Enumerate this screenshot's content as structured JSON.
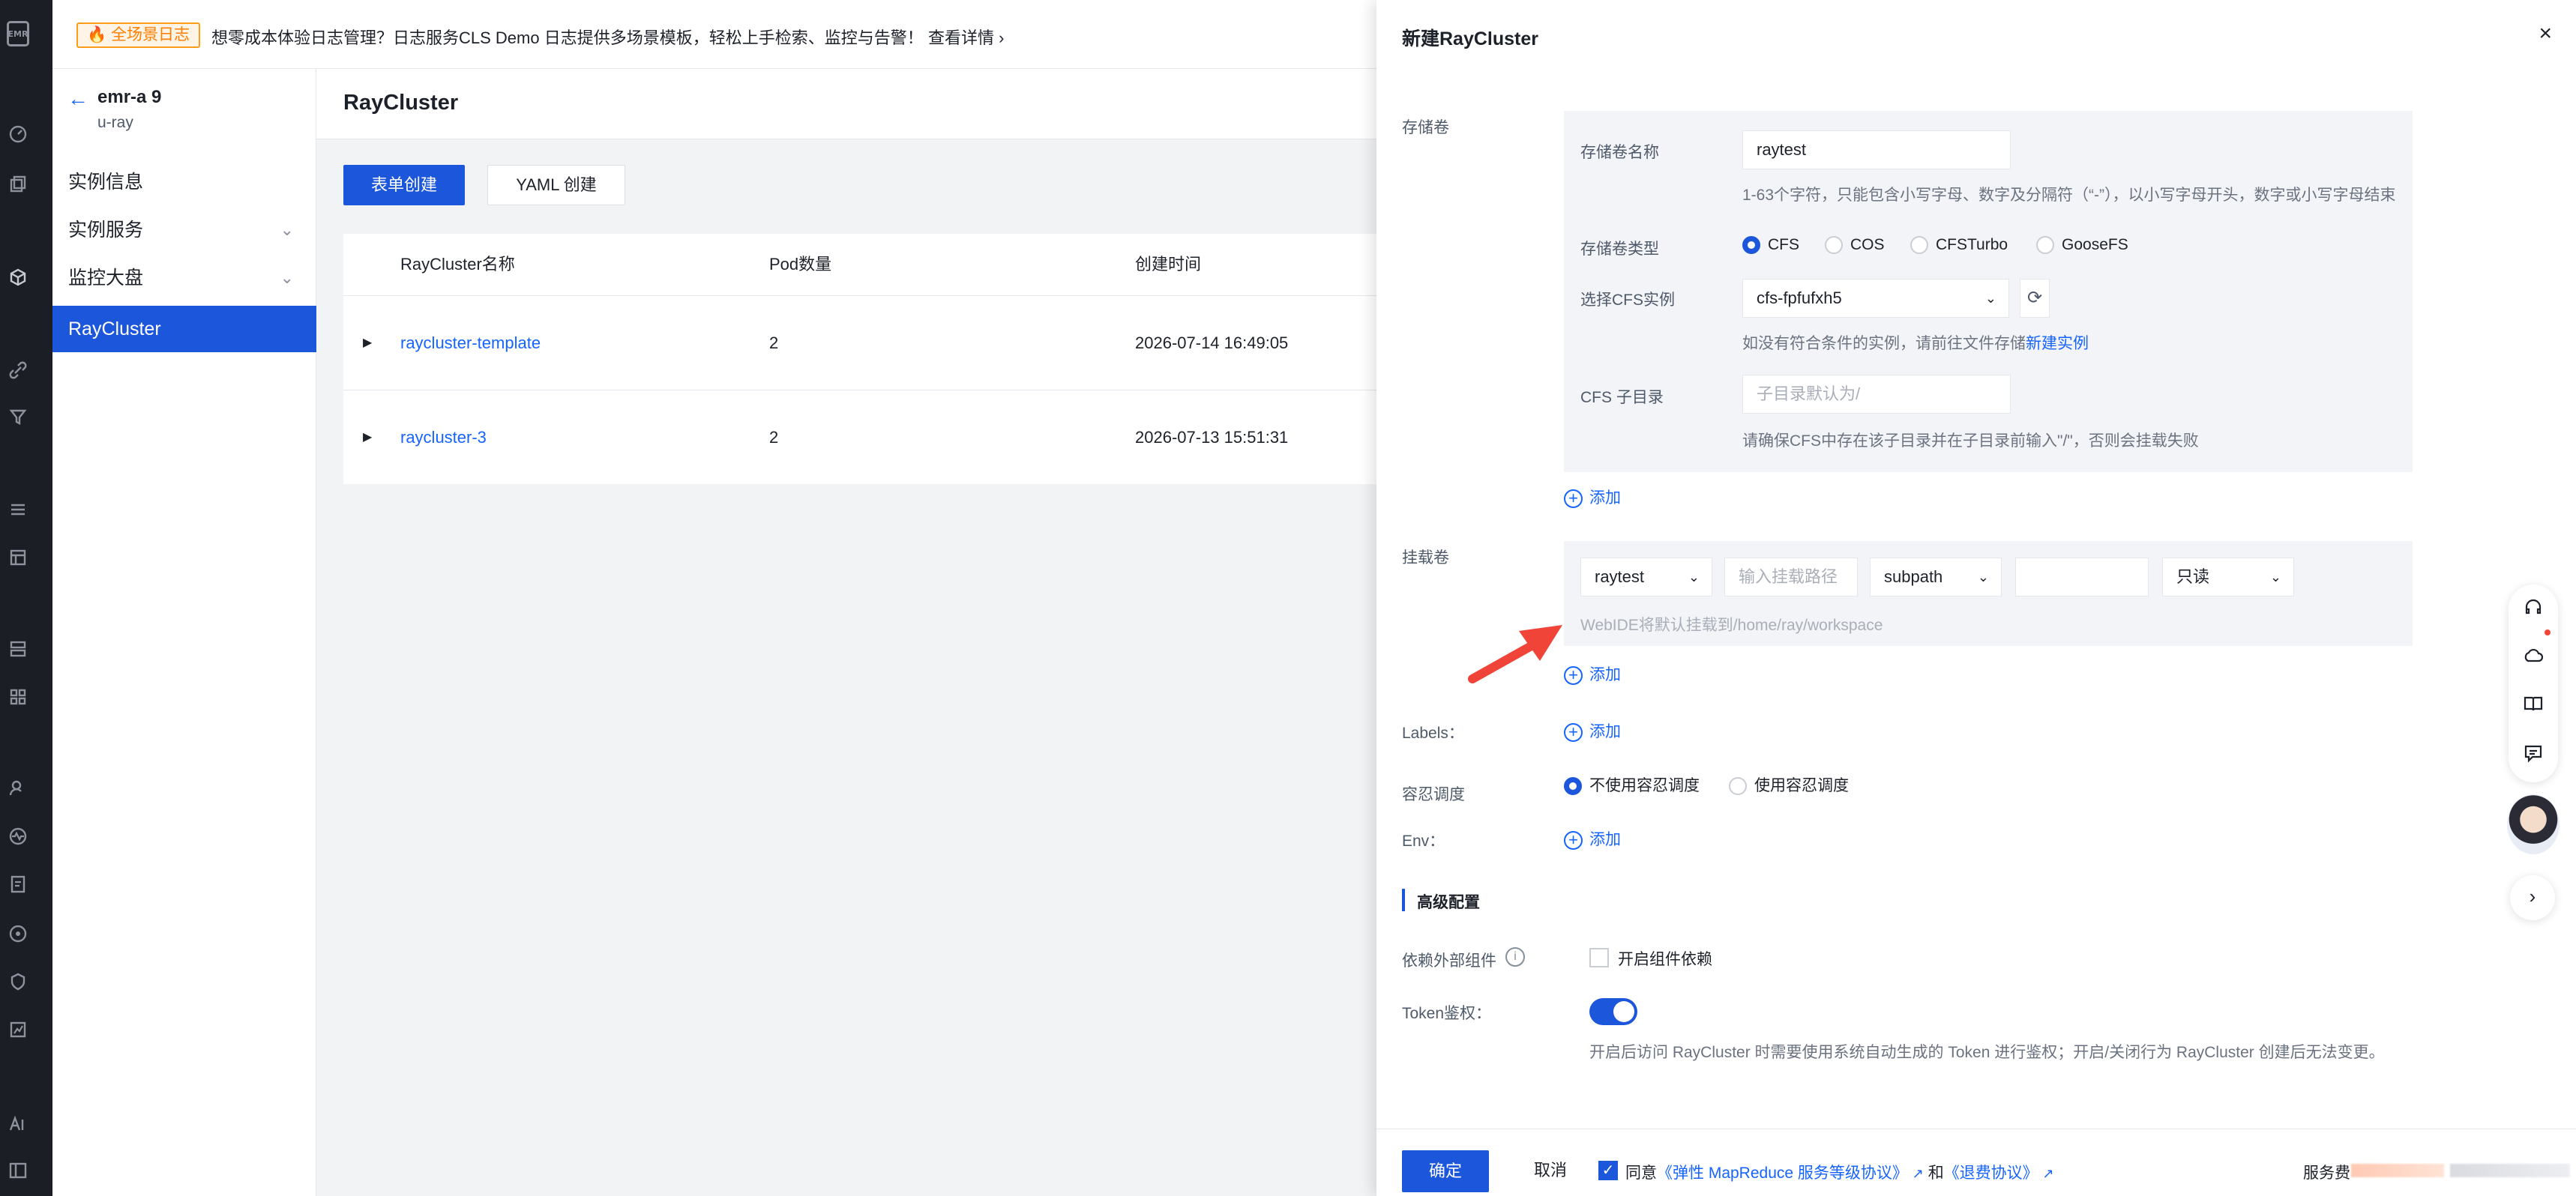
{
  "banner": {
    "tag": "全场景日志",
    "text": "想零成本体验日志管理？日志服务CLS Demo 日志提供多场景模板，轻松上手检索、监控与告警！",
    "link": "查看详情 ›"
  },
  "rail": {
    "logo": "EMR"
  },
  "subnav": {
    "back_icon": "arrow-left-icon",
    "title": "emr-a 9",
    "subtitle": "u-ray",
    "items": [
      {
        "label": "实例信息",
        "chevron": false
      },
      {
        "label": "实例服务",
        "chevron": true
      },
      {
        "label": "监控大盘",
        "chevron": true
      },
      {
        "label": "RayCluster",
        "chevron": false,
        "active": true
      }
    ]
  },
  "main": {
    "title": "RayCluster",
    "buttons": {
      "form_create": "表单创建",
      "yaml_create": "YAML 创建"
    },
    "table": {
      "columns": [
        "RayCluster名称",
        "Pod数量",
        "创建时间"
      ],
      "rows": [
        {
          "name": "raycluster-template",
          "pods": "2",
          "created": "2026-07-14 16:49:05"
        },
        {
          "name": "raycluster-3",
          "pods": "2",
          "created": "2026-07-13 15:51:31"
        }
      ]
    }
  },
  "drawer": {
    "title": "新建RayCluster",
    "close": "×",
    "storage": {
      "label": "存储卷",
      "name_label": "存储卷名称",
      "name_value": "raytest",
      "name_hint": "1-63个字符，只能包含小写字母、数字及分隔符（“-”），以小写字母开头，数字或小写字母结束",
      "type_label": "存储卷类型",
      "types": [
        "CFS",
        "COS",
        "CFSTurbo",
        "GooseFS"
      ],
      "type_selected": "CFS",
      "cfs_label": "选择CFS实例",
      "cfs_value": "cfs-fpfufxh5",
      "cfs_hint_prefix": "如没有符合条件的实例，请前往文件存储",
      "cfs_hint_link": "新建实例",
      "subdir_label": "CFS 子目录",
      "subdir_placeholder": "子目录默认为/",
      "subdir_hint": "请确保CFS中存在该子目录并在子目录前输入\"/\"，否则会挂载失败",
      "add": "添加"
    },
    "mount": {
      "label": "挂载卷",
      "volume": "raytest",
      "path_placeholder": "输入挂载路径",
      "subpath": "subpath",
      "subpath_value": "",
      "mode": "只读",
      "hint": "WebIDE将默认挂载到/home/ray/workspace",
      "add": "添加"
    },
    "labels": {
      "label": "Labels：",
      "add": "添加"
    },
    "toleration": {
      "label": "容忍调度",
      "options": [
        "不使用容忍调度",
        "使用容忍调度"
      ],
      "selected": "不使用容忍调度"
    },
    "env": {
      "label": "Env：",
      "add": "添加"
    },
    "advanced": {
      "title": "高级配置",
      "dep_label": "依赖外部组件",
      "dep_checkbox": "开启组件依赖",
      "token_label": "Token鉴权：",
      "token_on": true,
      "token_hint": "开启后访问 RayCluster 时需要使用系统自动生成的 Token 进行鉴权；开启/关闭行为 RayCluster 创建后无法变更。"
    },
    "footer": {
      "confirm": "确定",
      "cancel": "取消",
      "agree_prefix": "同意",
      "agreement_1": "《弹性 MapReduce 服务等级协议》",
      "and": "和",
      "agreement_2": "《退费协议》",
      "fee_label": "服务费"
    }
  },
  "colors": {
    "primary": "#1c56db",
    "link": "#1664ff",
    "rail_bg": "#1b1e25",
    "banner_tag": "#ff7d00",
    "annotation_arrow": "#f04438"
  }
}
